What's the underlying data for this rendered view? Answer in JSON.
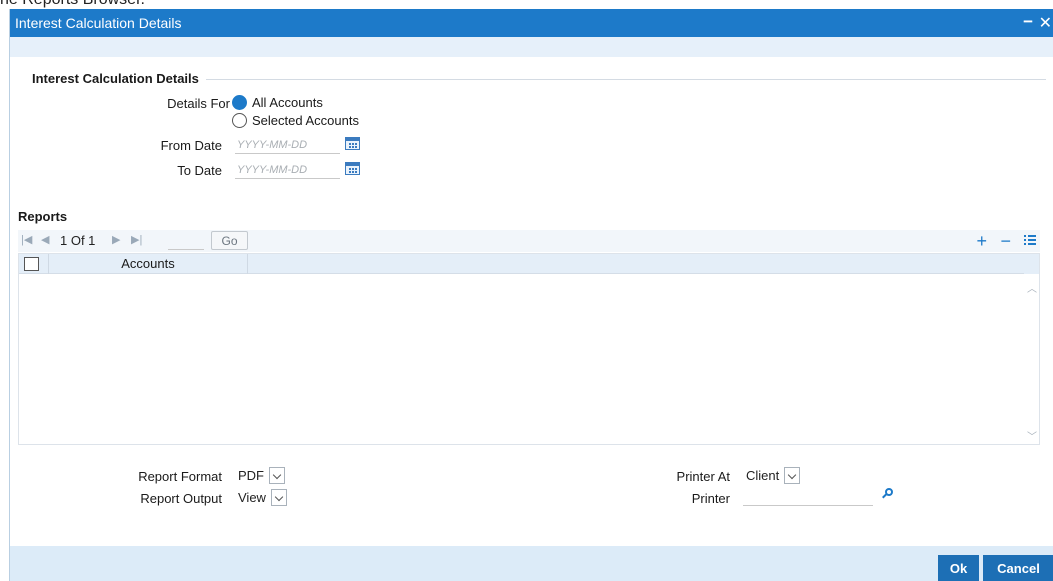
{
  "caption": "he Reports Browser.",
  "window": {
    "title": "Interest Calculation Details",
    "minimize_glyph": "−",
    "close_glyph": "✕"
  },
  "section": {
    "title": "Interest Calculation Details",
    "details_for_label": "Details For",
    "radio_all": "All Accounts",
    "radio_selected": "Selected Accounts",
    "selected_option": "All Accounts",
    "from_date_label": "From Date",
    "to_date_label": "To Date",
    "date_placeholder": "YYYY-MM-DD"
  },
  "reports": {
    "title": "Reports",
    "page_text": "1 Of 1",
    "go_label": "Go",
    "add_glyph": "+",
    "remove_glyph": "−",
    "column_accounts": "Accounts",
    "rows": []
  },
  "options": {
    "report_format_label": "Report Format",
    "report_format_value": "PDF",
    "report_output_label": "Report Output",
    "report_output_value": "View",
    "printer_at_label": "Printer At",
    "printer_at_value": "Client",
    "printer_label": "Printer",
    "printer_value": ""
  },
  "footer": {
    "ok_label": "Ok",
    "cancel_label": "Cancel"
  },
  "colors": {
    "titlebar": "#1d7ac9",
    "accent": "#1d7ac9",
    "footer_bg": "#dcebf8",
    "button_bg": "#1d6fb5"
  }
}
